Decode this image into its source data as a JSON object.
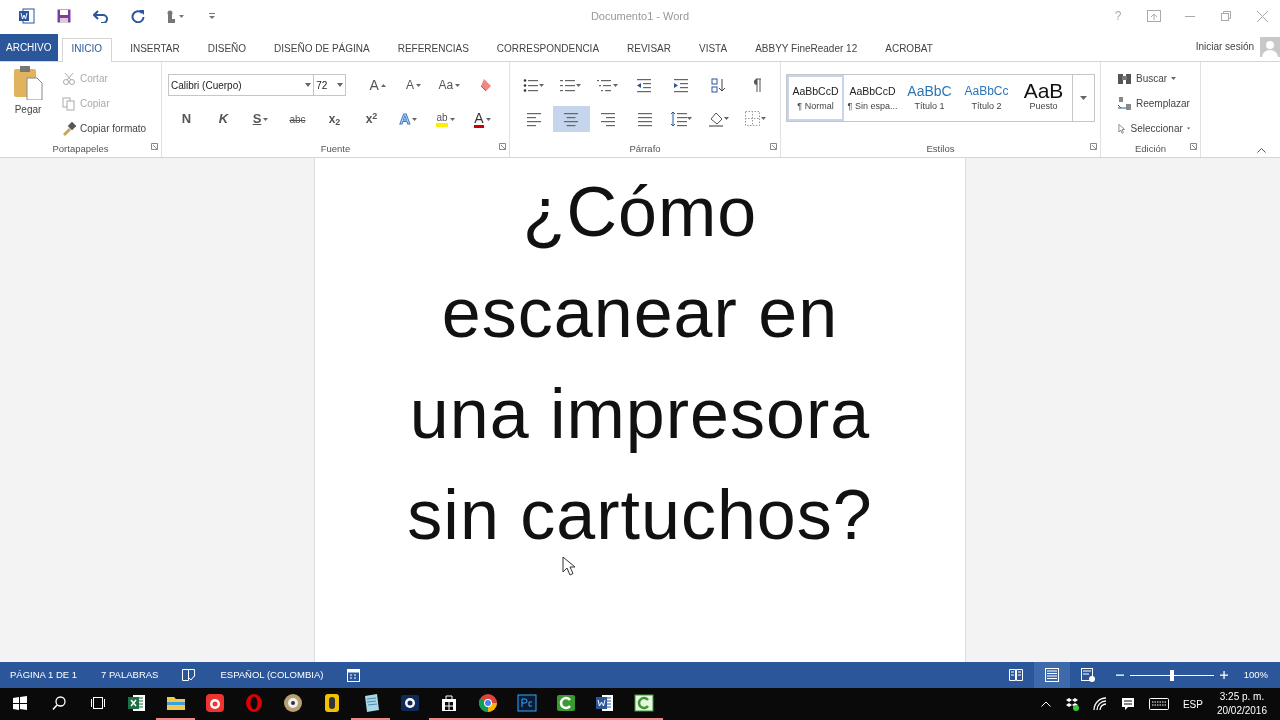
{
  "window": {
    "title": "Documento1 - Word",
    "help": "?"
  },
  "tabs": [
    {
      "label": "ARCHIVO",
      "kind": "file",
      "selected": false
    },
    {
      "label": "INICIO",
      "kind": "tab",
      "selected": true
    },
    {
      "label": "INSERTAR",
      "kind": "tab",
      "selected": false
    },
    {
      "label": "DISEÑO",
      "kind": "tab",
      "selected": false
    },
    {
      "label": "DISEÑO DE PÁGINA",
      "kind": "tab",
      "selected": false
    },
    {
      "label": "REFERENCIAS",
      "kind": "tab",
      "selected": false
    },
    {
      "label": "CORRESPONDENCIA",
      "kind": "tab",
      "selected": false
    },
    {
      "label": "REVISAR",
      "kind": "tab",
      "selected": false
    },
    {
      "label": "VISTA",
      "kind": "tab",
      "selected": false
    },
    {
      "label": "ABBYY FineReader 12",
      "kind": "tab",
      "selected": false
    },
    {
      "label": "ACROBAT",
      "kind": "tab",
      "selected": false
    }
  ],
  "account": {
    "sign_in": "Iniciar sesión"
  },
  "clipboard": {
    "title": "Portapapeles",
    "paste": "Pegar",
    "items": [
      {
        "label": "Cortar",
        "kind": "cut",
        "disabled": true
      },
      {
        "label": "Copiar",
        "kind": "copy",
        "disabled": true
      },
      {
        "label": "Copiar formato",
        "kind": "painter",
        "disabled": false
      }
    ]
  },
  "font": {
    "title": "Fuente",
    "family": "Calibri (Cuerpo)",
    "size": "72",
    "row1": [
      {
        "label": "A",
        "kind": "grow"
      },
      {
        "label": "A",
        "kind": "shrink"
      },
      {
        "label": "Aa",
        "kind": "case"
      }
    ],
    "row2": [
      {
        "label": "N",
        "kind": "bold"
      },
      {
        "label": "K",
        "kind": "italic"
      },
      {
        "label": "S",
        "kind": "underline"
      },
      {
        "label": "abc",
        "kind": "strike"
      },
      {
        "label": "x$_{2}$",
        "kind": "script"
      },
      {
        "label": "x$^{2}$",
        "kind": "script"
      },
      {
        "label": "A",
        "kind": "effects"
      },
      {
        "label": "ab",
        "kind": "highlight"
      },
      {
        "label": "A",
        "kind": "color"
      }
    ]
  },
  "paragraph": {
    "title": "Párrafo",
    "alignment": [
      {
        "selected": false
      },
      {
        "selected": true
      },
      {
        "selected": false
      },
      {
        "selected": false
      }
    ]
  },
  "styles": {
    "title": "Estilos",
    "items": [
      {
        "sample": "AaBbCcD",
        "name": "¶ Normal",
        "kind": "normal",
        "selected": true
      },
      {
        "sample": "AaBbCcD",
        "name": "¶ Sin espa...",
        "kind": "normal",
        "selected": false
      },
      {
        "sample": "AaBbC",
        "name": "Título 1",
        "kind": "heading1",
        "selected": false
      },
      {
        "sample": "AaBbCc",
        "name": "Título 2",
        "kind": "heading2",
        "selected": false
      },
      {
        "sample": "AaB",
        "name": "Puesto",
        "kind": "title",
        "selected": false
      }
    ]
  },
  "editing": {
    "title": "Edición",
    "items": [
      {
        "label": "Buscar",
        "kind": "find"
      },
      {
        "label": "Reemplazar",
        "kind": "replace"
      },
      {
        "label": "Seleccionar",
        "kind": "select"
      }
    ]
  },
  "document": {
    "lines": [
      "¿Cómo",
      "escanear en",
      "una impresora",
      "sin cartuchos?"
    ]
  },
  "status_bar": {
    "page": "PÁGINA 1 DE 1",
    "words": "7 PALABRAS",
    "language": "ESPAÑOL (COLOMBIA)",
    "views": [
      {
        "kind": "read",
        "selected": false
      },
      {
        "kind": "print",
        "selected": true
      },
      {
        "kind": "web",
        "selected": false
      }
    ],
    "zoom": {
      "level": 0.5,
      "reading": "100%"
    }
  },
  "taskbar": {
    "apps": [
      {
        "kind": "excel",
        "running": false
      },
      {
        "kind": "folder",
        "running": true
      },
      {
        "kind": "record",
        "running": false
      },
      {
        "kind": "opera",
        "running": false
      },
      {
        "kind": "disc",
        "running": false
      },
      {
        "kind": "phone",
        "running": false
      },
      {
        "kind": "notepad",
        "running": true
      },
      {
        "kind": "aperture",
        "running": false
      },
      {
        "kind": "store",
        "running": true
      },
      {
        "kind": "chrome",
        "running": true
      },
      {
        "kind": "ps",
        "running": true
      },
      {
        "kind": "camtasia",
        "running": true
      },
      {
        "kind": "word",
        "running": true
      },
      {
        "kind": "camtasia2",
        "running": true
      }
    ],
    "language": "ESP",
    "time": "3:25 p. m.",
    "date": "20/02/2016"
  }
}
